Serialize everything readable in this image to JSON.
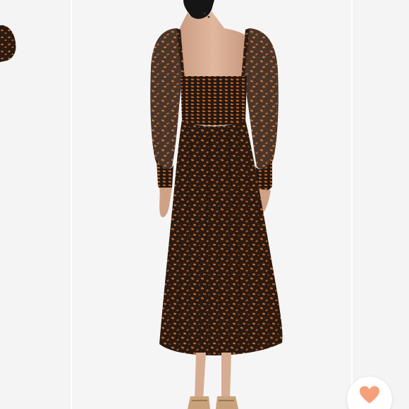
{
  "gallery": {
    "like_icon": "heart-icon",
    "colors": {
      "backdrop": "#f4f4f4",
      "heart": "#f4a07a",
      "dress_base": "#2a1a12",
      "dress_print": "#b8652b"
    }
  }
}
